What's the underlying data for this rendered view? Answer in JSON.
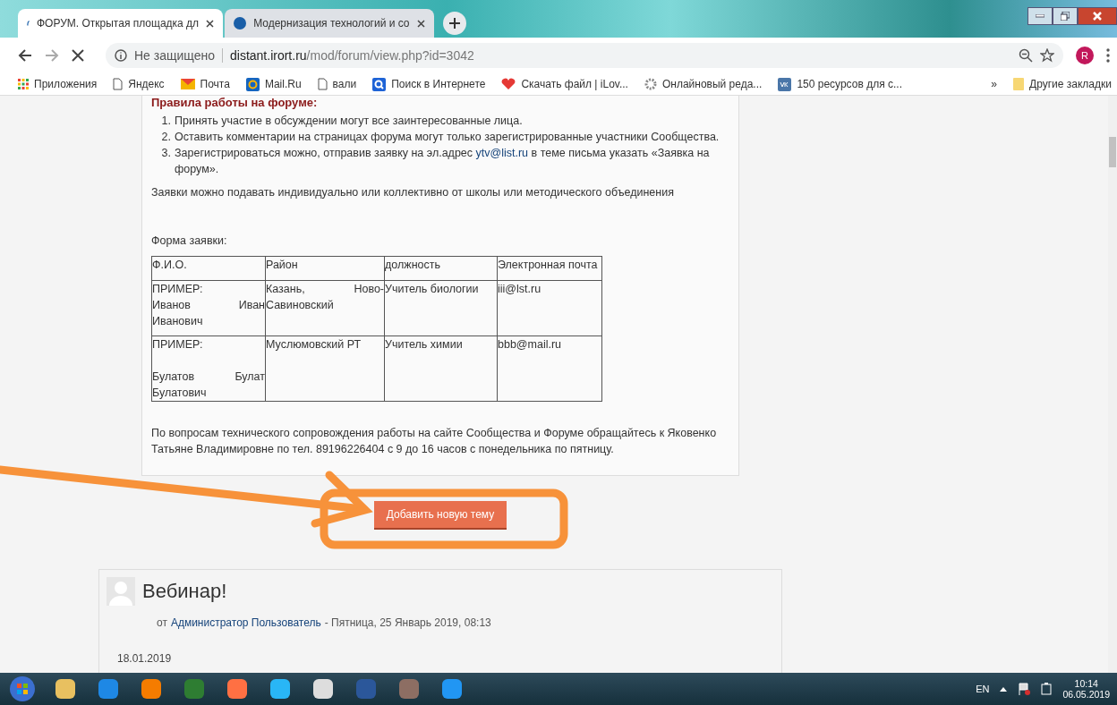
{
  "browser": {
    "tabs": [
      {
        "title": "ФОРУМ. Открытая площадка дл",
        "selected": true
      },
      {
        "title": "Модернизация технологий и со",
        "selected": false
      }
    ],
    "address": {
      "security": "Не защищено",
      "host": "distant.irort.ru",
      "path": "/mod/forum/view.php?id=3042"
    },
    "profile": "R",
    "bookmarks": [
      {
        "kind": "apps",
        "label": "Приложения"
      },
      {
        "kind": "page",
        "label": "Яндекс"
      },
      {
        "kind": "mail",
        "label": "Почта"
      },
      {
        "kind": "at",
        "label": "Mail.Ru"
      },
      {
        "kind": "page",
        "label": "вали"
      },
      {
        "kind": "search",
        "label": "Поиск в Интернете"
      },
      {
        "kind": "heart",
        "label": "Скачать файл | iLov..."
      },
      {
        "kind": "gear",
        "label": "Онлайновый реда..."
      },
      {
        "kind": "vk",
        "label": "150 ресурсов для с..."
      }
    ],
    "more": "»",
    "other_bookmarks": "Другие закладки"
  },
  "page": {
    "rules_heading": "Правила работы на форуме:",
    "rules": [
      {
        "marker": "1.",
        "text": "Принять участие в обсуждении могут все заинтересованные лица."
      },
      {
        "marker": "2.",
        "text": "Оставить комментарии на страницах форума могут только зарегистрированные участники Сообщества."
      },
      {
        "marker": "3.",
        "text": "Зарегистрироваться можно, отправив заявку на эл.адрес ",
        "link": "ytv@list.ru",
        "after": " в теме письма указать «Заявка на форум»."
      }
    ],
    "requests_note": "Заявки можно подавать индивидуально или коллективно от школы или методического объединения",
    "form_label": "Форма заявки:",
    "table": {
      "columns": [
        "Ф.И.О.",
        "Район",
        "должность",
        "Электронная почта"
      ],
      "rows": [
        [
          "ПРИМЕР:\nИванов Иван Иванович",
          "Казань, Ново-Савиновский",
          "Учитель биологии",
          "iii@lst.ru"
        ],
        [
          "ПРИМЕР:\n\nБулатов Булат Булатович",
          "Муслюмовский РТ",
          "Учитель химии",
          "bbb@mail.ru"
        ]
      ]
    },
    "contact_note": "По вопросам технического сопровождения работы на сайте Сообщества и Форуме обращайтесь к Яковенко Татьяне Владимировне по тел. 89196226404 с 9 до 16 часов с понедельника по пятницу.",
    "add_topic_button": "Добавить новую тему",
    "post": {
      "title": "Вебинар!",
      "by": "от",
      "author": "Администратор Пользователь",
      "date": "- Пятница, 25 Январь 2019, 08:13",
      "body_date": "18.01.2019"
    }
  },
  "taskbar": {
    "language": "EN",
    "time": "10:14",
    "date": "06.05.2019"
  }
}
